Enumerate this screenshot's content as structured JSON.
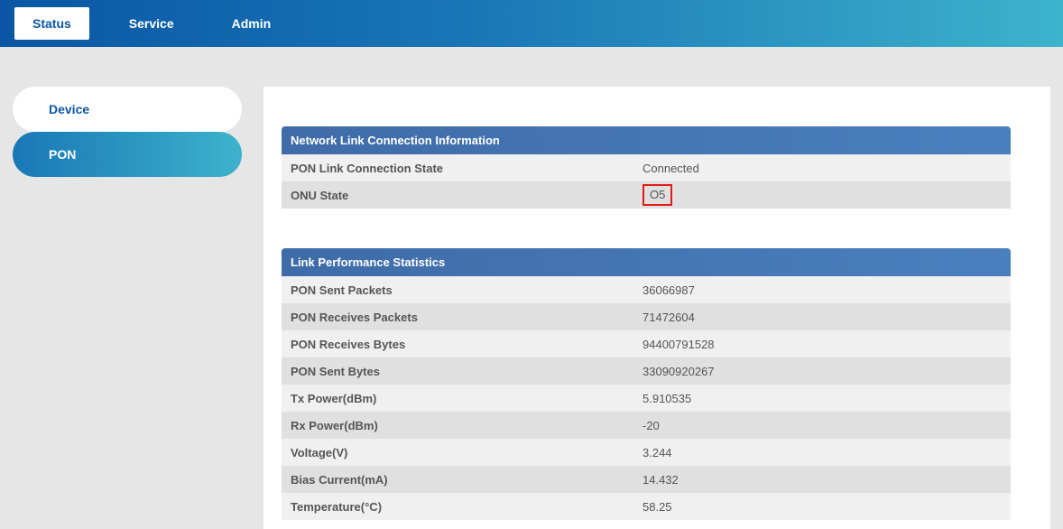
{
  "topnav": {
    "tabs": [
      {
        "label": "Status",
        "active": true
      },
      {
        "label": "Service",
        "active": false
      },
      {
        "label": "Admin",
        "active": false
      }
    ]
  },
  "sidebar": {
    "items": [
      {
        "label": "Device",
        "active": false
      },
      {
        "label": "PON",
        "active": true
      }
    ]
  },
  "sections": {
    "link_info": {
      "title": "Network Link Connection Information",
      "rows": [
        {
          "label": "PON Link Connection State",
          "value": "Connected",
          "highlight": false
        },
        {
          "label": "ONU State",
          "value": "O5",
          "highlight": true
        }
      ]
    },
    "perf_stats": {
      "title": "Link Performance Statistics",
      "rows": [
        {
          "label": "PON Sent Packets",
          "value": "36066987"
        },
        {
          "label": "PON Receives Packets",
          "value": "71472604"
        },
        {
          "label": "PON Receives Bytes",
          "value": "94400791528"
        },
        {
          "label": "PON Sent Bytes",
          "value": "33090920267"
        },
        {
          "label": "Tx Power(dBm)",
          "value": "5.910535"
        },
        {
          "label": "Rx Power(dBm)",
          "value": "-20"
        },
        {
          "label": "Voltage(V)",
          "value": "3.244"
        },
        {
          "label": "Bias Current(mA)",
          "value": "14.432"
        },
        {
          "label": "Temperature(°C)",
          "value": "58.25"
        }
      ]
    }
  }
}
